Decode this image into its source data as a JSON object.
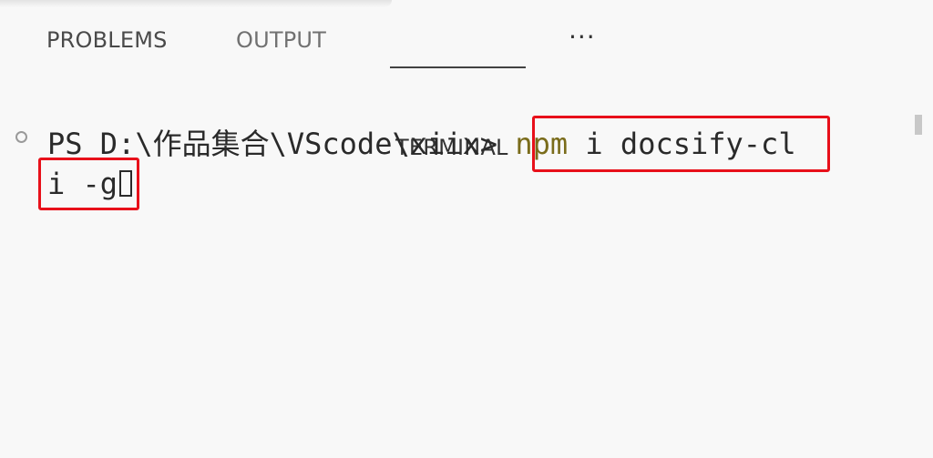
{
  "tabs": {
    "problems": "PROBLEMS",
    "output": "OUTPUT",
    "terminal": "TERMINAL",
    "more": "···",
    "active": "TERMINAL"
  },
  "terminal": {
    "prompt": "PS D:\\作品集合\\VScode\\xiix> ",
    "command_name": "npm",
    "command_args_line1": " i docsify-cl",
    "command_args_line2": "i -g",
    "command_name_color": "#7a6c1b",
    "highlight_color": "#e8101a"
  }
}
